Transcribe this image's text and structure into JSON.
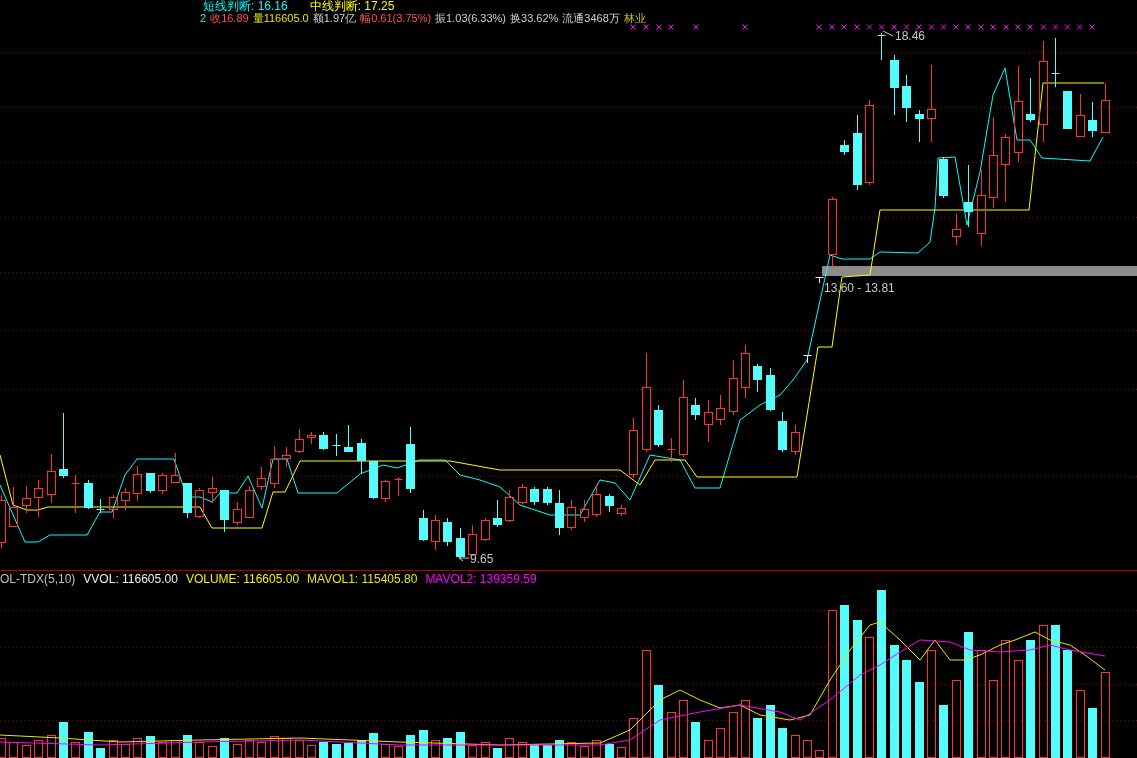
{
  "header": {
    "indicators": [
      {
        "text": "短线判断: 16.16",
        "color": "#00ffff"
      },
      {
        "text": "中线判断: 17.25",
        "color": "#ffff00"
      }
    ],
    "quote": [
      {
        "text": "2",
        "kind": "prefix"
      },
      {
        "text": "收16.89",
        "kind": "rise"
      },
      {
        "text": "量116605.0",
        "kind": "volume"
      },
      {
        "text": "额1.97亿",
        "kind": "plain"
      },
      {
        "text": "幅0.61(3.75%)",
        "kind": "rise"
      },
      {
        "text": "振1.03(6.33%)",
        "kind": "plain"
      },
      {
        "text": "换33.62%",
        "kind": "plain"
      },
      {
        "text": "流通3468万",
        "kind": "plain"
      },
      {
        "text": "林业",
        "kind": "sector"
      }
    ]
  },
  "price_chart": {
    "high_price": "18.46",
    "low_price": "9.65",
    "gap_range": "13.60 - 13.81"
  },
  "volume_chart": {
    "legend": [
      {
        "text": "OL-TDX(5,10)",
        "kind": "name"
      },
      {
        "text": "VVOL: 116605.00",
        "kind": "value"
      },
      {
        "text": "VOLUME: 116605.00",
        "kind": "volume"
      },
      {
        "text": "MAVOL1: 115405.80",
        "kind": "fast"
      },
      {
        "text": "MAVOL2: 139359.59",
        "kind": "slow"
      }
    ]
  }
}
